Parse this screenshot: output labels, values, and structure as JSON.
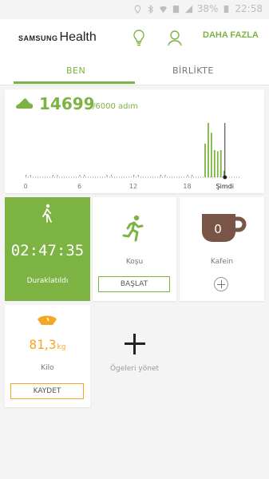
{
  "status_bar": {
    "battery_percent": "38%",
    "time": "22:58",
    "icons": [
      "location-icon",
      "bluetooth-icon",
      "wifi-icon",
      "sim-icon",
      "signal-icon",
      "battery-icon"
    ]
  },
  "header": {
    "brand_prefix": "SAMSUNG",
    "brand_name": "Health",
    "more_label": "DAHA FAZLA",
    "icons": [
      "lightbulb-icon",
      "profile-icon"
    ]
  },
  "tabs": [
    {
      "label": "BEN",
      "active": true
    },
    {
      "label": "BİRLİKTE",
      "active": false
    }
  ],
  "colors": {
    "accent": "#7cb342",
    "weight": "#f5a623",
    "coffee": "#795548"
  },
  "steps": {
    "count": "14699",
    "goal": "/6000 adım",
    "now_label": "Şimdi"
  },
  "chart_data": {
    "type": "bar",
    "x_ticks": [
      "0",
      "6",
      "12",
      "18"
    ],
    "now_label": "Şimdi",
    "xlim": [
      0,
      24
    ],
    "now_hour": 22.2,
    "bars": [
      {
        "hour": 20.0,
        "value": 62
      },
      {
        "hour": 20.35,
        "value": 100
      },
      {
        "hour": 20.7,
        "value": 82
      },
      {
        "hour": 21.05,
        "value": 50
      },
      {
        "hour": 21.4,
        "value": 48
      },
      {
        "hour": 21.75,
        "value": 50
      },
      {
        "hour": 22.1,
        "value": 12
      }
    ],
    "ylim": [
      0,
      100
    ]
  },
  "tiles": {
    "walk": {
      "time": "02:47:35",
      "status": "Duraklatıldı"
    },
    "run": {
      "label": "Koşu",
      "button": "BAŞLAT"
    },
    "coffee": {
      "label": "Kafein",
      "count": "0"
    },
    "weight": {
      "int": "81",
      "dec": "3",
      "unit": "kg",
      "label": "Kilo",
      "button": "KAYDET"
    },
    "manage": {
      "label": "Ögeleri yönet"
    }
  }
}
